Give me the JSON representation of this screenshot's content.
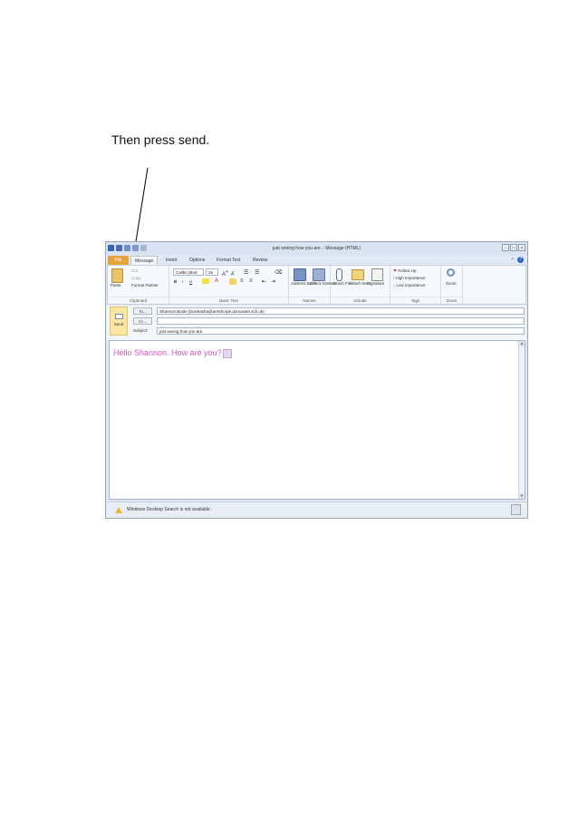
{
  "instruction": "Then press send.",
  "window": {
    "title": "just seeing how you are. - Message (HTML)",
    "tabs": [
      "File",
      "Message",
      "Insert",
      "Options",
      "Format Text",
      "Review"
    ]
  },
  "ribbon": {
    "clipboard": {
      "paste": "Paste",
      "cut": "Cut",
      "copy": "Copy",
      "format_painter": "Format Painter",
      "label": "Clipboard"
    },
    "basic_text": {
      "font": "Calibri (Bod",
      "size": "16",
      "bold": "B",
      "italic": "I",
      "underline": "U",
      "label": "Basic Text"
    },
    "names": {
      "address_book": "Address Book",
      "check_names": "Check Names",
      "label": "Names"
    },
    "include": {
      "attach_file": "Attach File",
      "attach_item": "Attach Item",
      "signature": "Signature",
      "label": "Include"
    },
    "tags": {
      "follow_up": "Follow Up",
      "high": "High Importance",
      "low": "Low Importance",
      "label": "Tags"
    },
    "zoom": {
      "zoom": "Zoom",
      "label": "Zoom"
    }
  },
  "compose": {
    "send": "Send",
    "to_button": "To...",
    "cc_button": "Cc...",
    "subject_label": "Subject:",
    "to_value": "Shannon Boole (bosleasha@armthorpe.doncaster.sch.uk)",
    "cc_value": "",
    "subject_value": "just seeing how you are."
  },
  "message_body": "Hello Shannon. How are you?",
  "status_bar": "Windows Desktop Search is not available.",
  "colors": {
    "file_tab": "#e8a23a",
    "send_highlight": "#fbe7a2",
    "body_text": "#d55bc6"
  }
}
